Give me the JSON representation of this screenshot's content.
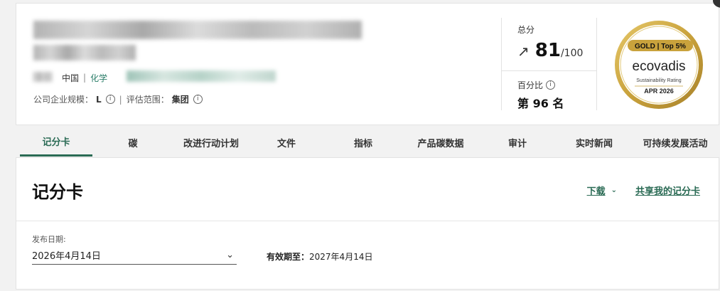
{
  "header": {
    "country": "中国",
    "industry_prefix": "化学",
    "company_size_label": "公司企业规模：",
    "company_size_value": "L",
    "scope_label": "评估范围：",
    "scope_value": "集团",
    "separator": "|"
  },
  "score": {
    "label": "总分",
    "value": "81",
    "max": "/100",
    "percentile_label": "百分比",
    "rank": "第 96 名"
  },
  "badge": {
    "tier": "GOLD",
    "top": "Top 5%",
    "brand": "ecovadis",
    "subtitle": "Sustainability Rating",
    "date": "APR 2026",
    "color": "#c9a23c"
  },
  "tabs": [
    {
      "label": "记分卡",
      "active": true
    },
    {
      "label": "碳"
    },
    {
      "label": "改进行动计划"
    },
    {
      "label": "文件"
    },
    {
      "label": "指标"
    },
    {
      "label": "产品碳数据"
    },
    {
      "label": "审计"
    },
    {
      "label": "实时新闻"
    },
    {
      "label": "可持续发展活动"
    }
  ],
  "main": {
    "title": "记分卡",
    "download_label": "下载",
    "share_label": "共享我的记分卡",
    "publish_date_label": "发布日期:",
    "publish_date_value": "2026年4月14日",
    "valid_until_label": "有效期至：",
    "valid_until_value": "2027年4月14日"
  },
  "colors": {
    "accent": "#2b6b55",
    "gold": "#c9a23c"
  }
}
